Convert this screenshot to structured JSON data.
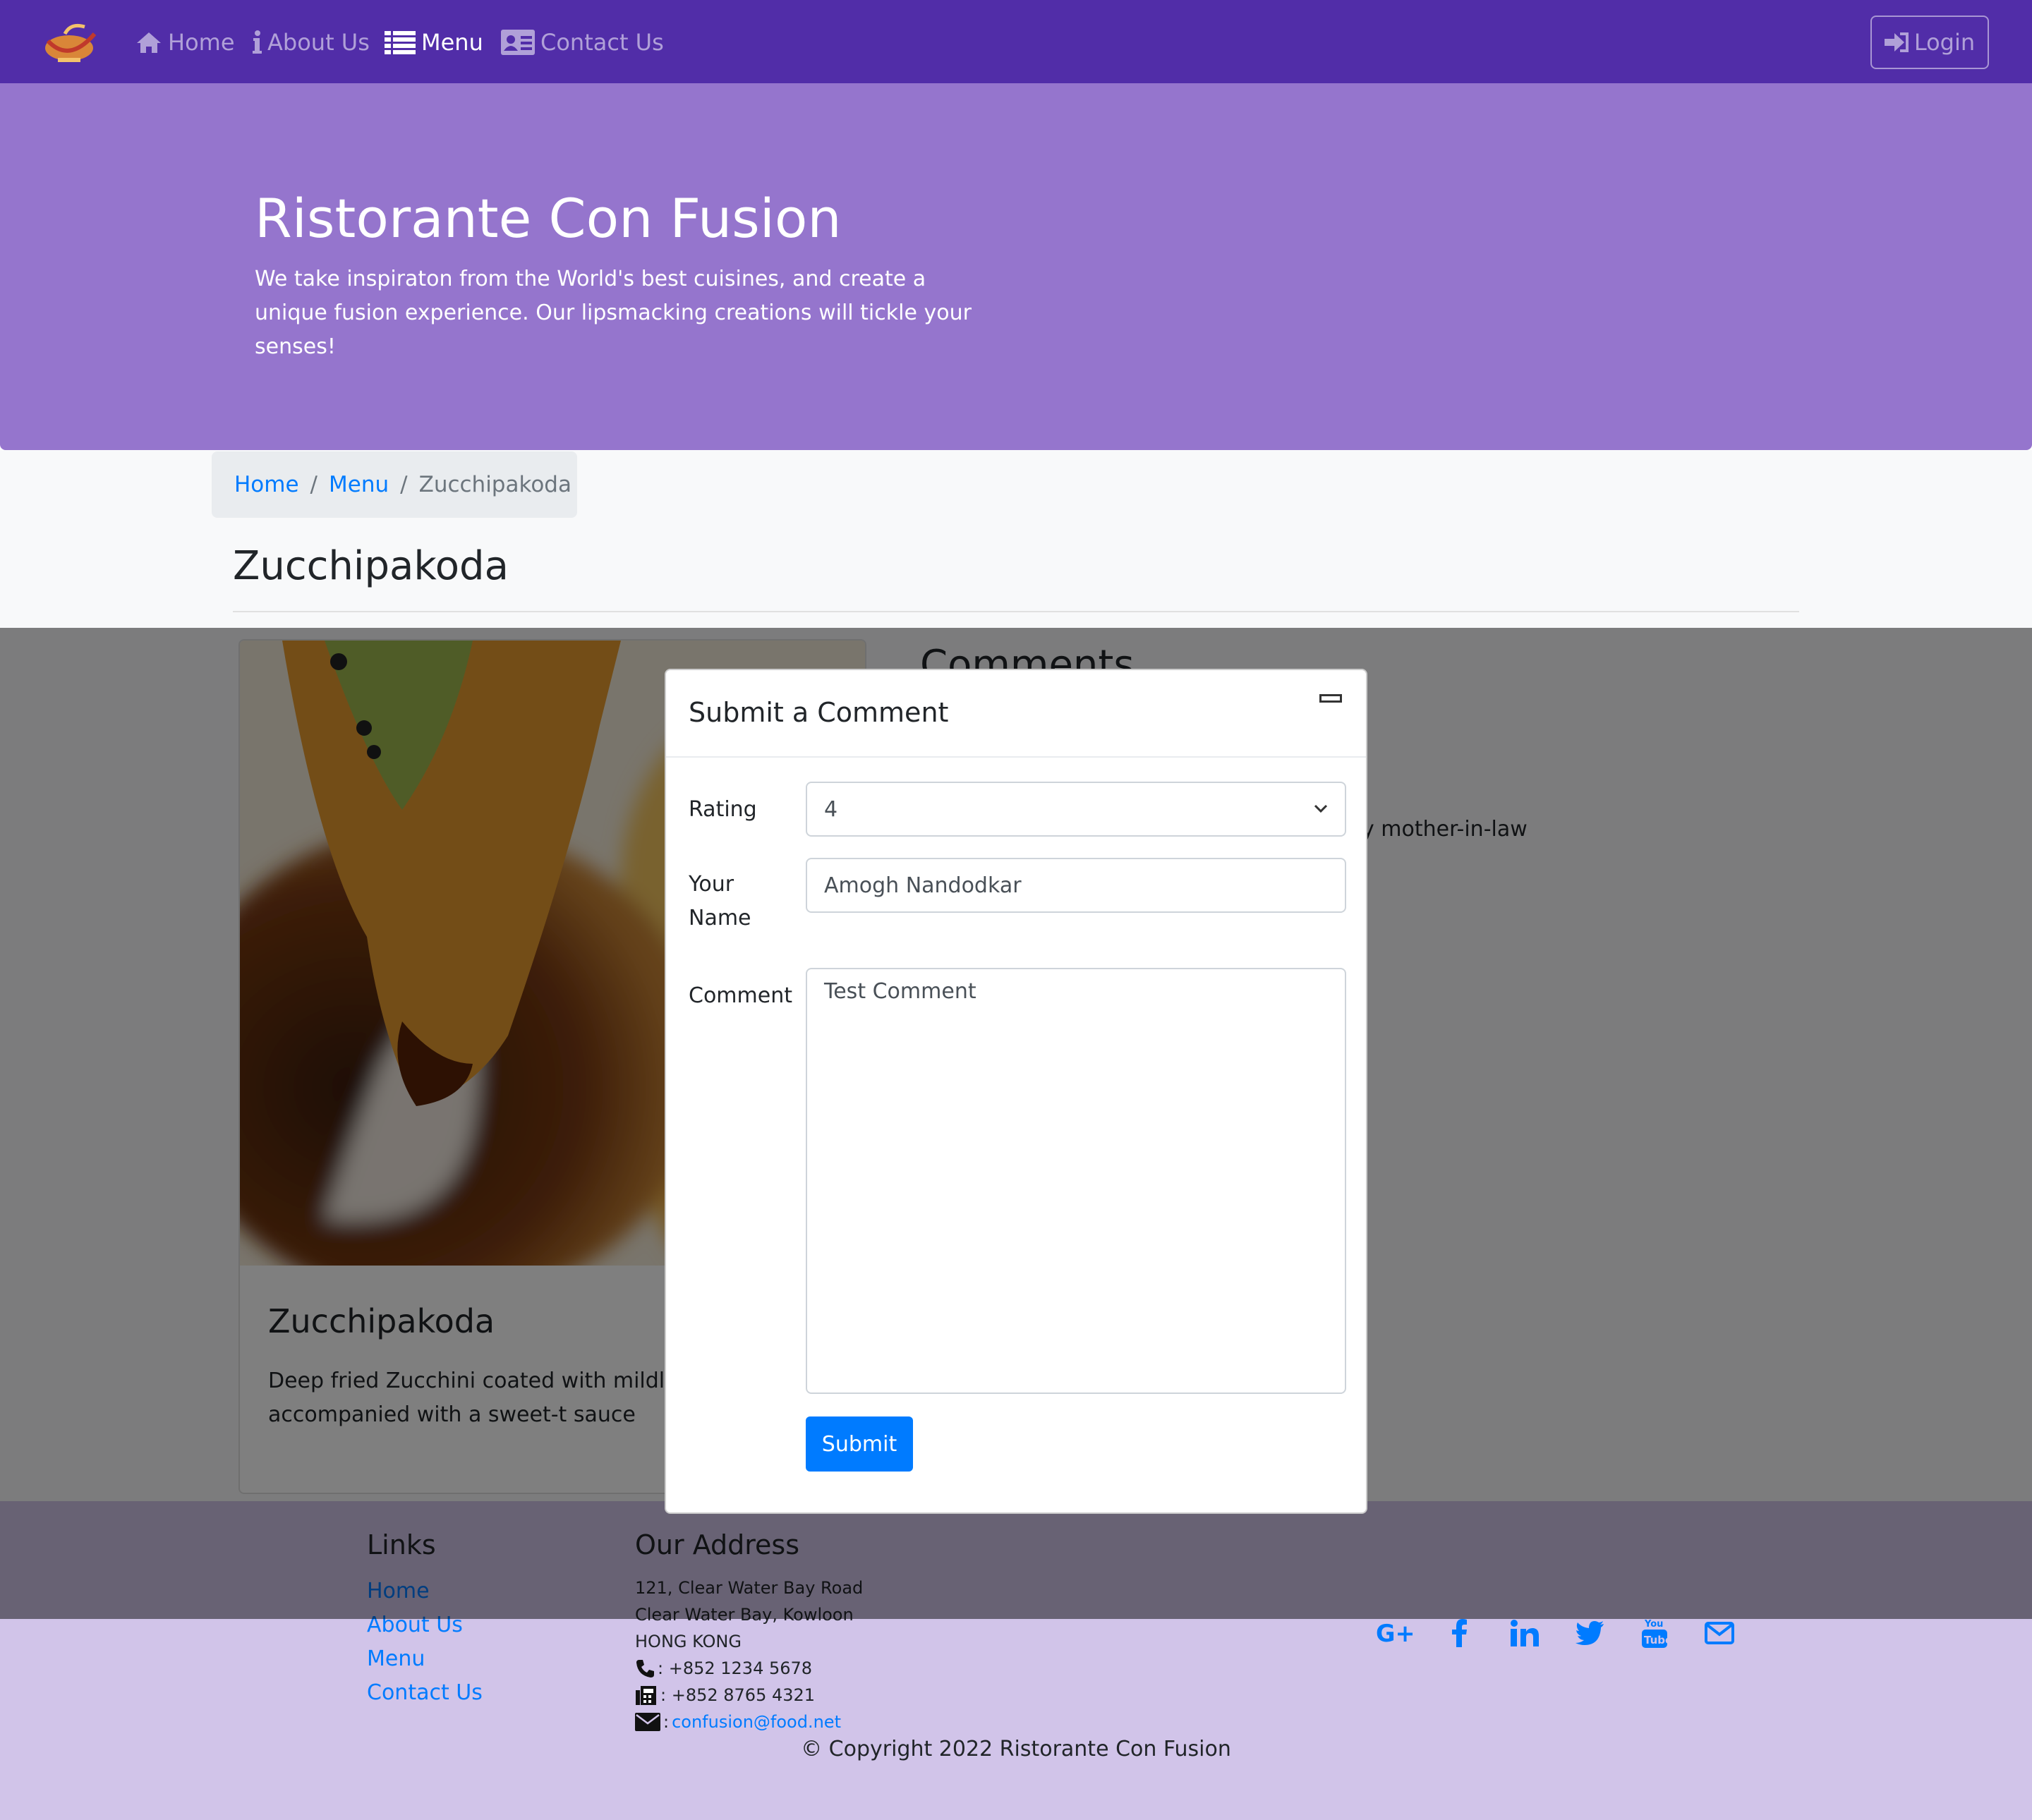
{
  "navbar": {
    "items": [
      {
        "label": "Home",
        "icon": "home-icon"
      },
      {
        "label": "About Us",
        "icon": "info-icon"
      },
      {
        "label": "Menu",
        "icon": "list-icon"
      },
      {
        "label": "Contact Us",
        "icon": "address-card-icon"
      }
    ],
    "active": "Menu",
    "login_label": "Login"
  },
  "jumbotron": {
    "title": "Ristorante Con Fusion",
    "text": "We take inspiraton from the World's best cuisines, and create a unique fusion experience. Our lipsmacking creations will tickle your senses!"
  },
  "breadcrumb": {
    "items": [
      "Home",
      "Menu"
    ],
    "current": "Zucchipakoda"
  },
  "page": {
    "title": "Zucchipakoda"
  },
  "dish": {
    "name": "Zucchipakoda",
    "description": "Deep fried Zucchini coated with mildly s flour batter accompanied with a sweet-t sauce"
  },
  "comments": {
    "title": "Comments",
    "visible_fragment": "y mother-in-law"
  },
  "modal": {
    "title": "Submit a Comment",
    "rating_label": "Rating",
    "rating_value": "4",
    "name_label_line1": "Your",
    "name_label_line2": "Name",
    "name_value": "Amogh Nandodkar",
    "comment_label": "Comment",
    "comment_value": "Test Comment",
    "submit_label": "Submit"
  },
  "footer": {
    "links_title": "Links",
    "links": [
      "Home",
      "About Us",
      "Menu",
      "Contact Us"
    ],
    "address_title": "Our Address",
    "address_lines": [
      "121, Clear Water Bay Road",
      "Clear Water Bay, Kowloon",
      "HONG KONG"
    ],
    "phone": ": +852 1234 5678",
    "fax": ": +852 8765 4321",
    "email": "confusion@food.net",
    "email_prefix": ":",
    "social_icons": [
      "google-plus-icon",
      "facebook-icon",
      "linkedin-icon",
      "twitter-icon",
      "youtube-icon",
      "envelope-icon"
    ],
    "copyright": "© Copyright 2022 Ristorante Con Fusion"
  },
  "colors": {
    "navbar": "#512da8",
    "jumbotron": "#9575cd",
    "footer": "#d1c4e9",
    "primary": "#007bff"
  }
}
